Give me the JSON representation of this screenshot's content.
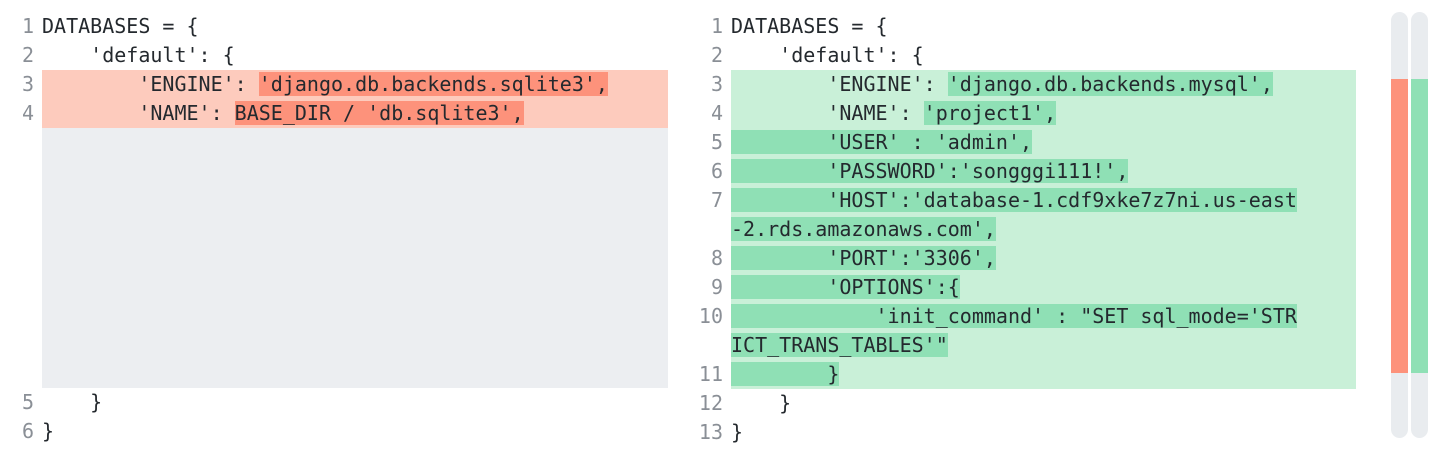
{
  "left": {
    "lines": [
      {
        "num": "1",
        "pre": "DATABASES = {",
        "hl": "",
        "post": ""
      },
      {
        "num": "2",
        "pre": "    'default': {",
        "hl": "",
        "post": ""
      },
      {
        "num": "3",
        "pre": "        'ENGINE': ",
        "hl": "'django.db.backends.sqlite3',",
        "post": ""
      },
      {
        "num": "4",
        "pre": "        'NAME': ",
        "hl": "BASE_DIR / 'db.sqlite3',",
        "post": ""
      },
      {
        "num": "5",
        "pre": "    }",
        "hl": "",
        "post": ""
      },
      {
        "num": "6",
        "pre": "}",
        "hl": "",
        "post": ""
      }
    ]
  },
  "right": {
    "lines": [
      {
        "num": "1",
        "pre": "DATABASES = {",
        "hl": ""
      },
      {
        "num": "2",
        "pre": "    'default': {",
        "hl": ""
      },
      {
        "num": "3",
        "pre": "        'ENGINE': ",
        "hl": "'django.db.backends.mysql',"
      },
      {
        "num": "4",
        "pre": "        'NAME': ",
        "hl": "'project1',"
      },
      {
        "num": "5",
        "pre": "",
        "hl": "        'USER' : 'admin',"
      },
      {
        "num": "6",
        "pre": "",
        "hl": "        'PASSWORD':'songggi111!',"
      },
      {
        "num": "7",
        "pre": "",
        "hl": "        'HOST':'database-1.cdf9xke7z7ni.us-east"
      },
      {
        "num": "",
        "pre": "",
        "hl": "-2.rds.amazonaws.com',"
      },
      {
        "num": "8",
        "pre": "",
        "hl": "        'PORT':'3306',"
      },
      {
        "num": "9",
        "pre": "",
        "hl": "        'OPTIONS':{"
      },
      {
        "num": "10",
        "pre": "",
        "hl": "            'init_command' : \"SET sql_mode='STR"
      },
      {
        "num": "",
        "pre": "",
        "hl": "ICT_TRANS_TABLES'\""
      },
      {
        "num": "11",
        "pre": "",
        "hl": "        }"
      },
      {
        "num": "12",
        "pre": "    }",
        "hl": ""
      },
      {
        "num": "13",
        "pre": "}",
        "hl": ""
      }
    ]
  },
  "colors": {
    "deleted_line": "#fdcbbd",
    "deleted_highlight": "#fd927b",
    "added_line": "#c9f0d8",
    "added_highlight": "#8fe0b5",
    "filler": "#eceef1",
    "line_number": "#8a8f96"
  },
  "scrollbars": {
    "left_marker": "deleted",
    "right_marker": "added"
  }
}
